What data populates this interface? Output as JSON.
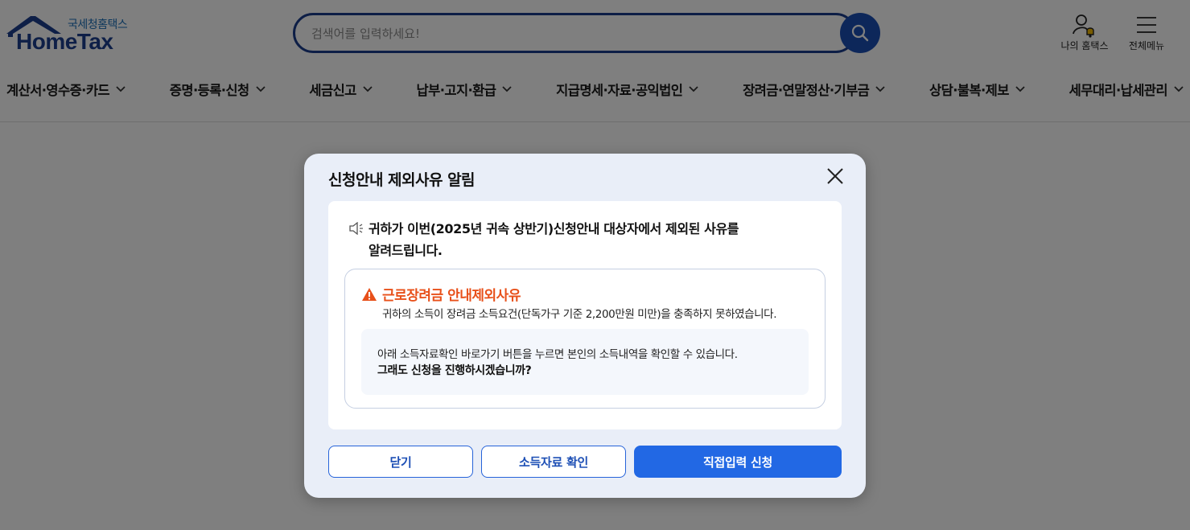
{
  "logo": {
    "subtitle": "국세청홈택스",
    "name": "HomeTax"
  },
  "search": {
    "placeholder": "검색어를 입력하세요!",
    "icon": "search-icon"
  },
  "utility": {
    "my_hometax": "나의 홈택스",
    "all_menu": "전체메뉴"
  },
  "gnb": {
    "items": [
      {
        "label": "계산서·영수증·카드"
      },
      {
        "label": "증명·등록·신청"
      },
      {
        "label": "세금신고"
      },
      {
        "label": "납부·고지·환급"
      },
      {
        "label": "지급명세·자료·공익법인"
      },
      {
        "label": "장려금·연말정산·기부금"
      },
      {
        "label": "상담·불복·제보"
      },
      {
        "label": "세무대리·납세관리"
      }
    ]
  },
  "modal": {
    "title": "신청안내 제외사유 알림",
    "notice_line1": "귀하가 이번(2025년 귀속 상반기)신청안내 대상자에서 제외된 사유를",
    "notice_line2": "알려드립니다.",
    "reason_title": "근로장려금 안내제외사유",
    "reason_desc": "귀하의 소득이 장려금 소득요건(단독가구 기준 2,200만원 미만)을 충족하지 못하였습니다.",
    "info_line1": "아래 소득자료확인 바로가기 버튼을 누르면 본인의 소득내역을 확인할 수 있습니다.",
    "info_line2": "그래도 신청을 진행하시겠습니까?",
    "buttons": {
      "close": "닫기",
      "income_check": "소득자료 확인",
      "direct_apply": "직접입력 신청"
    }
  },
  "colors": {
    "brand_navy": "#1b3d8c",
    "primary_blue": "#2268e4",
    "warning_orange": "#e8501a",
    "modal_bg": "#e9eef8"
  }
}
